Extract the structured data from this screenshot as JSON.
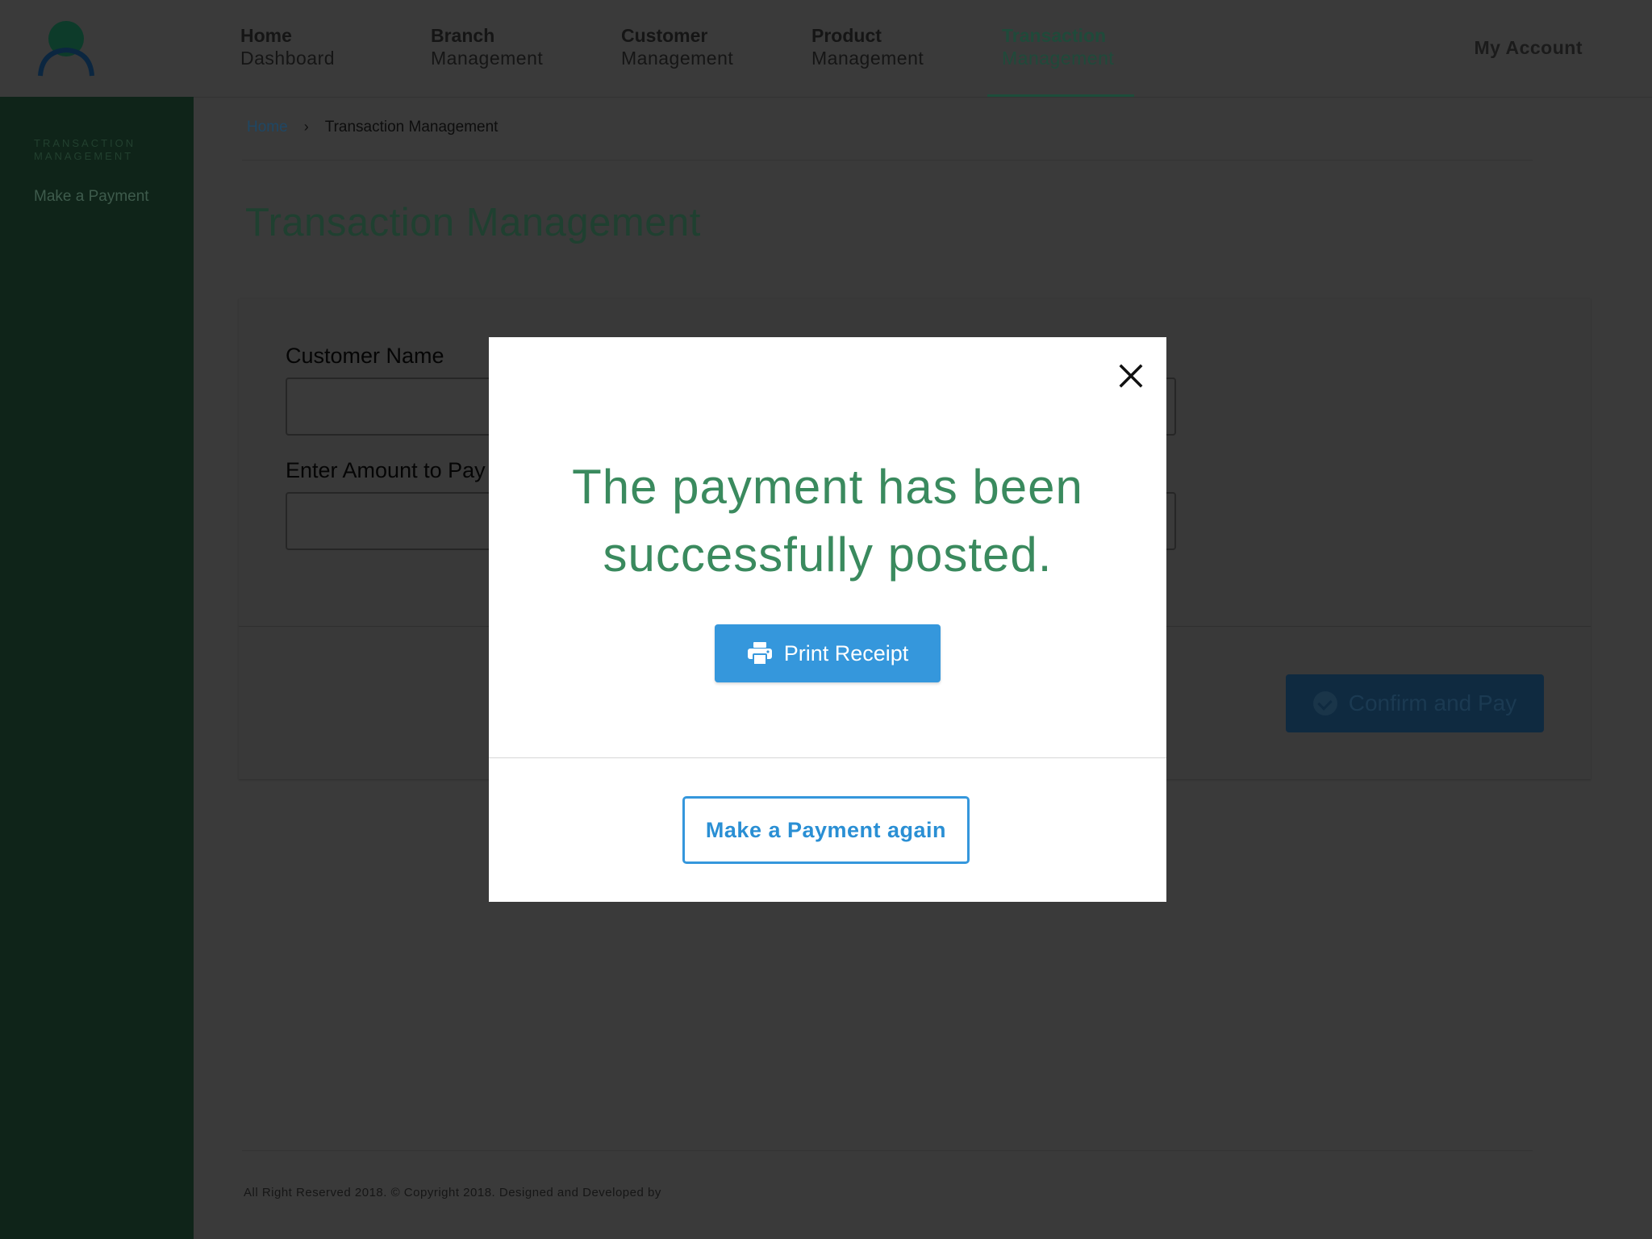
{
  "nav": {
    "items": [
      {
        "line1": "Home",
        "line2": "Dashboard"
      },
      {
        "line1": "Branch",
        "line2": "Management"
      },
      {
        "line1": "Customer",
        "line2": "Management"
      },
      {
        "line1": "Product",
        "line2": "Management"
      },
      {
        "line1": "Transaction",
        "line2": "Management"
      }
    ],
    "active_index": 4,
    "account": "My Account"
  },
  "sidebar": {
    "heading_line1": "TRANSACTION",
    "heading_line2": "MANAGEMENT",
    "items": [
      {
        "label": "Make a Payment"
      }
    ]
  },
  "breadcrumb": {
    "home": "Home",
    "separator": "›",
    "current": "Transaction Management"
  },
  "page": {
    "title": "Transaction Management"
  },
  "form": {
    "customer_label": "Customer Name",
    "customer_value": "",
    "amount_label": "Enter Amount to Pay",
    "amount_value": "",
    "confirm_label": "Confirm and Pay"
  },
  "modal": {
    "message_line1": "The payment has been",
    "message_line2": "successfully posted.",
    "print_label": "Print Receipt",
    "again_label": "Make a Payment again",
    "close_icon": "close-icon"
  },
  "footer": {
    "text": "All Right Reserved 2018. © Copyright 2018. Designed and Developed by"
  },
  "colors": {
    "accent_blue": "#3597dc",
    "brand_green": "#3a8a5e",
    "sidebar_green": "#0f2419",
    "overlay": "#3a3a3a"
  }
}
